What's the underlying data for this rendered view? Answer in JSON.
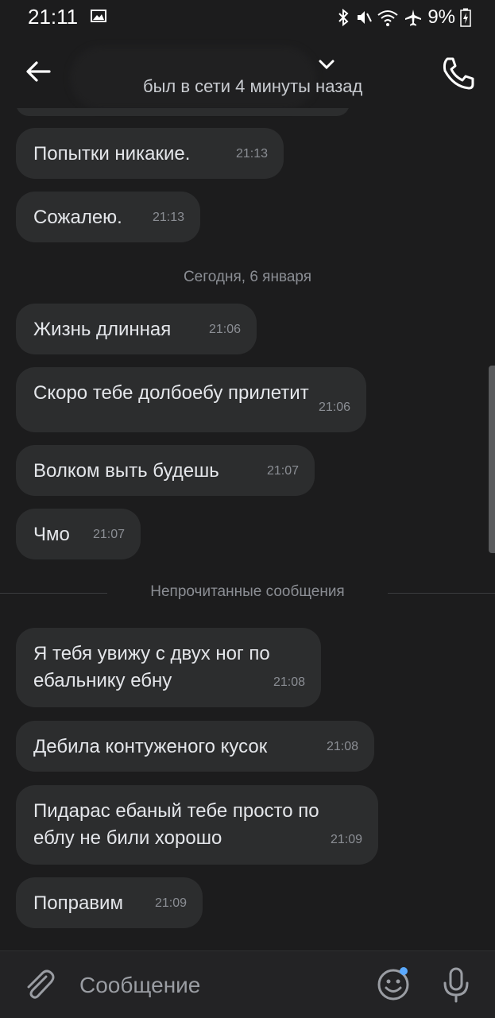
{
  "status_bar": {
    "time": "21:11",
    "battery": "9%"
  },
  "header": {
    "last_seen": "был в сети 4 минуты назад"
  },
  "date_separator": "Сегодня, 6 января",
  "unread_separator": "Непрочитанные сообщения",
  "messages_before": [
    {
      "text": "Попытки никакие.",
      "time": "21:13"
    },
    {
      "text": "Сожалею.",
      "time": "21:13"
    }
  ],
  "messages_today": [
    {
      "text": "Жизнь длинная",
      "time": "21:06"
    },
    {
      "text": "Скоро тебе долбоебу прилетит",
      "time": "21:06"
    },
    {
      "text": "Волком выть будешь",
      "time": "21:07"
    },
    {
      "text": "Чмо",
      "time": "21:07"
    }
  ],
  "messages_unread": [
    {
      "text": "Я тебя увижу с двух ног по\nебальнику ебну",
      "time": "21:08"
    },
    {
      "text": "Дебила контуженого кусок",
      "time": "21:08"
    },
    {
      "text": "Пидарас ебаный тебе просто по\nеблу не били хорошо",
      "time": "21:09"
    },
    {
      "text": "Поправим",
      "time": "21:09"
    }
  ],
  "composer": {
    "placeholder": "Сообщение"
  },
  "colors": {
    "background": "#1c1c1d",
    "bubble": "#2c2d2e",
    "accent_dot": "#5aa9ff"
  }
}
